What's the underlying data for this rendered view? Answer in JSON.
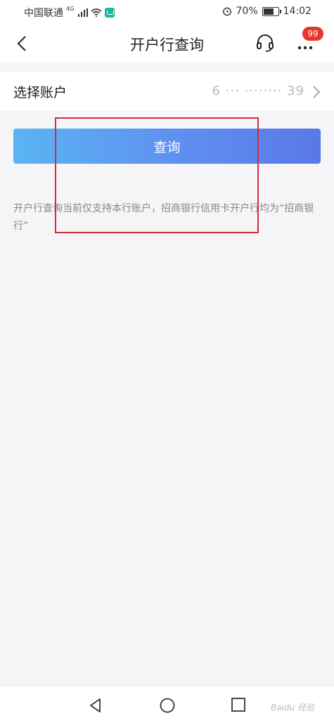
{
  "status_bar": {
    "carrier": "中国联通",
    "network": "4G",
    "battery": "70%",
    "time": "14:02"
  },
  "header": {
    "title": "开户行查询",
    "badge_count": "99"
  },
  "account": {
    "label": "选择账户",
    "number_masked": "6 ··· ········ 39"
  },
  "query_button": {
    "label": "查询"
  },
  "note": "开户行查询当前仅支持本行账户，招商银行信用卡开户行均为“招商银行”",
  "watermark": "Baidu 经验",
  "colors": {
    "button_start": "#5ab4f3",
    "button_end": "#5a78e8",
    "badge": "#e7362a",
    "annotation_box": "#d22d3a"
  },
  "icons": [
    "back-arrow-icon",
    "headset-icon",
    "more-icon",
    "chevron-right-icon",
    "nav-back-icon",
    "nav-home-icon",
    "nav-recent-icon",
    "alarm-icon",
    "wifi-icon",
    "signal-icon",
    "battery-icon"
  ]
}
